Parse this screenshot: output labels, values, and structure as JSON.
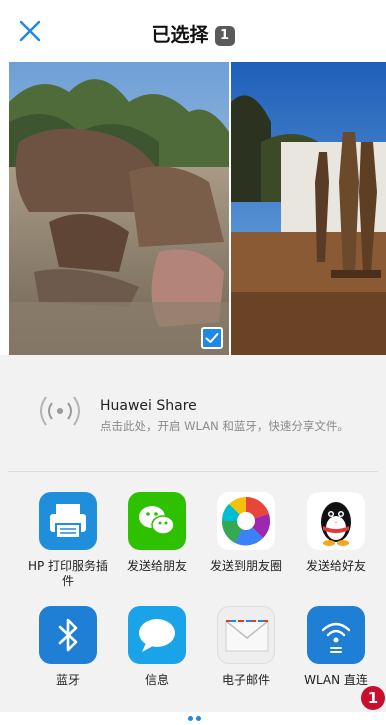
{
  "header": {
    "title": "已选择",
    "selected_count": "1",
    "close_icon": "close-icon"
  },
  "photos": [
    {
      "name": "rhino-sculptures-photo",
      "selected": true
    },
    {
      "name": "wooden-statues-photo",
      "selected": false
    }
  ],
  "huawei_share": {
    "title": "Huawei Share",
    "subtitle": "点击此处，开启 WLAN 和蓝牙，快速分享文件。",
    "icon": "wireless-broadcast-icon"
  },
  "apps": [
    {
      "label": "HP 打印服务插件",
      "icon": "printer-icon",
      "color": "#1f8fdc"
    },
    {
      "label": "发送给朋友",
      "icon": "wechat-icon",
      "color": "#2dc100"
    },
    {
      "label": "发送到朋友圈",
      "icon": "moments-aperture-icon",
      "color": "#ffffff"
    },
    {
      "label": "发送给好友",
      "icon": "qq-penguin-icon",
      "color": "#ffffff"
    },
    {
      "label": "蓝牙",
      "icon": "bluetooth-icon",
      "color": "#1f7fd4"
    },
    {
      "label": "信息",
      "icon": "message-bubble-icon",
      "color": "#1aa3e8"
    },
    {
      "label": "电子邮件",
      "icon": "envelope-icon",
      "color": "#eeeeee"
    },
    {
      "label": "WLAN 直连",
      "icon": "wlan-direct-icon",
      "color": "#1f7fd4"
    }
  ],
  "annotation": {
    "number": "1",
    "color": "#c8102e"
  },
  "accent_color": "#1e88e5"
}
